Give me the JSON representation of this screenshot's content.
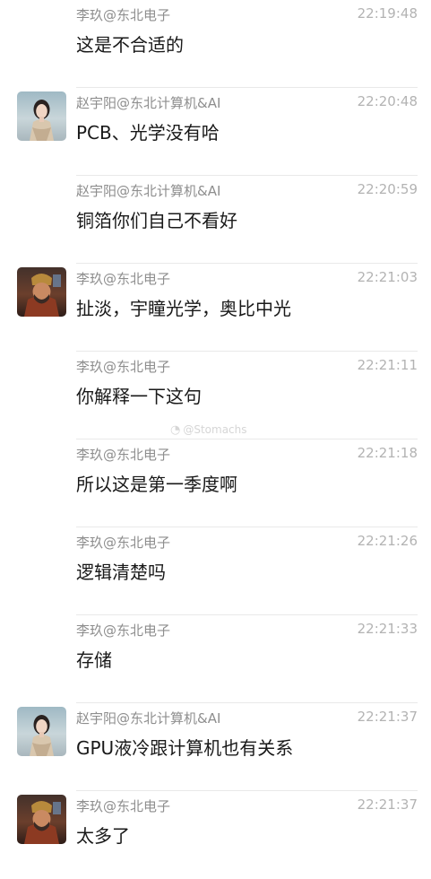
{
  "messages": [
    {
      "sender": "李玖@东北电子",
      "time": "22:19:48",
      "text": "这是不合适的",
      "avatar": "none"
    },
    {
      "sender": "赵宇阳@东北计算机&AI",
      "time": "22:20:48",
      "text": "PCB、光学没有哈",
      "avatar": "woman-avatar"
    },
    {
      "sender": "赵宇阳@东北计算机&AI",
      "time": "22:20:59",
      "text": "铜箔你们自己不看好",
      "avatar": "none"
    },
    {
      "sender": "李玖@东北电子",
      "time": "22:21:03",
      "text": "扯淡，宇瞳光学，奥比中光",
      "avatar": "warrior-avatar"
    },
    {
      "sender": "李玖@东北电子",
      "time": "22:21:11",
      "text": "你解释一下这句",
      "avatar": "none"
    },
    {
      "sender": "李玖@东北电子",
      "time": "22:21:18",
      "text": "所以这是第一季度啊",
      "avatar": "none"
    },
    {
      "sender": "李玖@东北电子",
      "time": "22:21:26",
      "text": "逻辑清楚吗",
      "avatar": "none"
    },
    {
      "sender": "李玖@东北电子",
      "time": "22:21:33",
      "text": "存储",
      "avatar": "none"
    },
    {
      "sender": "赵宇阳@东北计算机&AI",
      "time": "22:21:37",
      "text": "GPU液冷跟计算机也有关系",
      "avatar": "woman-avatar"
    },
    {
      "sender": "李玖@东北电子",
      "time": "22:21:37",
      "text": "太多了",
      "avatar": "warrior-avatar"
    }
  ],
  "watermark": {
    "icon": "weibo-icon",
    "text": "@Stomachs"
  }
}
